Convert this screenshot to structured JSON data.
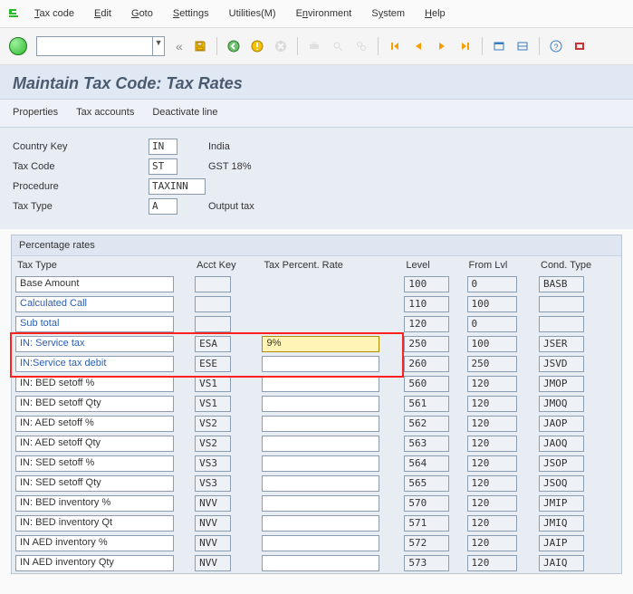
{
  "menu": {
    "items": [
      "Tax code",
      "Edit",
      "Goto",
      "Settings",
      "Utilities(M)",
      "Environment",
      "System",
      "Help"
    ]
  },
  "title": "Maintain Tax Code: Tax Rates",
  "actions": [
    "Properties",
    "Tax accounts",
    "Deactivate line"
  ],
  "header": {
    "rows": [
      {
        "label": "Country Key",
        "value": "IN",
        "desc": "India"
      },
      {
        "label": "Tax Code",
        "value": "ST",
        "desc": "GST 18%"
      },
      {
        "label": "Procedure",
        "value": "TAXINN",
        "desc": ""
      },
      {
        "label": "Tax Type",
        "value": "A",
        "desc": "Output tax"
      }
    ]
  },
  "table": {
    "title": "Percentage rates",
    "columns": [
      "Tax Type",
      "Acct Key",
      "Tax Percent. Rate",
      "Level",
      "From Lvl",
      "Cond. Type"
    ],
    "rows": [
      {
        "label": "Base Amount",
        "key": "",
        "rate": "",
        "level": "100",
        "from": "0",
        "cond": "BASB",
        "link": false,
        "editable": false
      },
      {
        "label": "Calculated Call",
        "key": "",
        "rate": "",
        "level": "110",
        "from": "100",
        "cond": "",
        "link": true,
        "editable": false
      },
      {
        "label": "Sub total",
        "key": "",
        "rate": "",
        "level": "120",
        "from": "0",
        "cond": "",
        "link": true,
        "editable": false
      },
      {
        "label": "IN: Service tax",
        "key": "ESA",
        "rate": "9%",
        "level": "250",
        "from": "100",
        "cond": "JSER",
        "link": true,
        "editable": true,
        "focus": true,
        "hl": true
      },
      {
        "label": "IN:Service tax debit",
        "key": "ESE",
        "rate": "",
        "level": "260",
        "from": "250",
        "cond": "JSVD",
        "link": true,
        "editable": true,
        "hl": true
      },
      {
        "label": "IN: BED setoff %",
        "key": "VS1",
        "rate": "",
        "level": "560",
        "from": "120",
        "cond": "JMOP",
        "link": false,
        "editable": true
      },
      {
        "label": "IN: BED setoff Qty",
        "key": "VS1",
        "rate": "",
        "level": "561",
        "from": "120",
        "cond": "JMOQ",
        "link": false,
        "editable": true
      },
      {
        "label": "IN: AED setoff %",
        "key": "VS2",
        "rate": "",
        "level": "562",
        "from": "120",
        "cond": "JAOP",
        "link": false,
        "editable": true
      },
      {
        "label": "IN: AED setoff Qty",
        "key": "VS2",
        "rate": "",
        "level": "563",
        "from": "120",
        "cond": "JAOQ",
        "link": false,
        "editable": true
      },
      {
        "label": "IN: SED setoff %",
        "key": "VS3",
        "rate": "",
        "level": "564",
        "from": "120",
        "cond": "JSOP",
        "link": false,
        "editable": true
      },
      {
        "label": "IN: SED setoff Qty",
        "key": "VS3",
        "rate": "",
        "level": "565",
        "from": "120",
        "cond": "JSOQ",
        "link": false,
        "editable": true
      },
      {
        "label": "IN: BED inventory %",
        "key": "NVV",
        "rate": "",
        "level": "570",
        "from": "120",
        "cond": "JMIP",
        "link": false,
        "editable": true
      },
      {
        "label": "IN: BED inventory Qt",
        "key": "NVV",
        "rate": "",
        "level": "571",
        "from": "120",
        "cond": "JMIQ",
        "link": false,
        "editable": true
      },
      {
        "label": "IN AED inventory %",
        "key": "NVV",
        "rate": "",
        "level": "572",
        "from": "120",
        "cond": "JAIP",
        "link": false,
        "editable": true
      },
      {
        "label": "IN AED inventory Qty",
        "key": "NVV",
        "rate": "",
        "level": "573",
        "from": "120",
        "cond": "JAIQ",
        "link": false,
        "editable": true
      }
    ]
  },
  "icons": {
    "save": "save",
    "back": "back",
    "exit": "exit",
    "cancel": "cancel",
    "print": "print",
    "find": "find",
    "findnext": "findnext",
    "first": "first",
    "prev": "prev",
    "next": "next",
    "last": "last",
    "newwin": "newwin",
    "layout": "layout",
    "help": "help",
    "tool": "tool"
  }
}
